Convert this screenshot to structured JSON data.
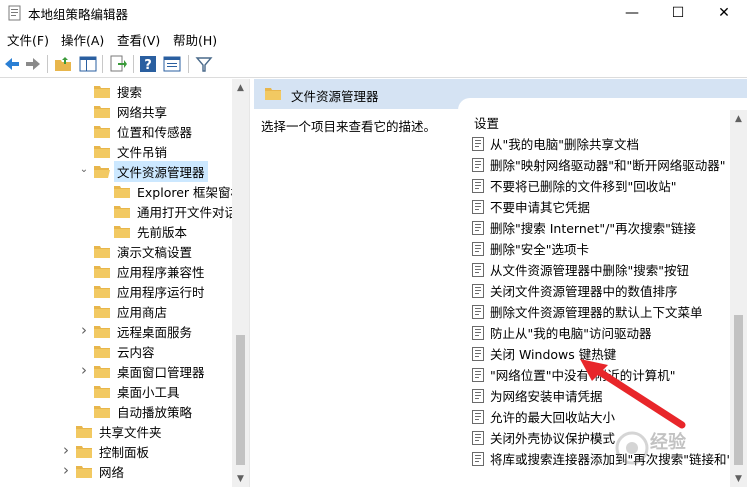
{
  "window": {
    "title": "本地组策略编辑器",
    "minimize_glyph": "—",
    "maximize_glyph": "☐",
    "close_glyph": "✕"
  },
  "menu": [
    "文件(F)",
    "操作(A)",
    "查看(V)",
    "帮助(H)"
  ],
  "toolbar_icons": [
    "back-arrow-icon",
    "forward-arrow-icon",
    "up-folder-icon",
    "show-tree-icon",
    "export-list-icon",
    "help-icon",
    "properties-icon",
    "filter-icon"
  ],
  "tree": {
    "items": [
      {
        "label": "搜索",
        "indent": 1,
        "expand": ""
      },
      {
        "label": "网络共享",
        "indent": 1,
        "expand": ""
      },
      {
        "label": "位置和传感器",
        "indent": 1,
        "expand": ""
      },
      {
        "label": "文件吊销",
        "indent": 1,
        "expand": ""
      },
      {
        "label": "文件资源管理器",
        "indent": 1,
        "expand": "open",
        "selected": true
      },
      {
        "label": "Explorer 框架窗格",
        "indent": 2,
        "expand": ""
      },
      {
        "label": "通用打开文件对话框",
        "indent": 2,
        "expand": ""
      },
      {
        "label": "先前版本",
        "indent": 2,
        "expand": ""
      },
      {
        "label": "演示文稿设置",
        "indent": 1,
        "expand": ""
      },
      {
        "label": "应用程序兼容性",
        "indent": 1,
        "expand": ""
      },
      {
        "label": "应用程序运行时",
        "indent": 1,
        "expand": ""
      },
      {
        "label": "应用商店",
        "indent": 1,
        "expand": ""
      },
      {
        "label": "远程桌面服务",
        "indent": 1,
        "expand": "closed"
      },
      {
        "label": "云内容",
        "indent": 1,
        "expand": ""
      },
      {
        "label": "桌面窗口管理器",
        "indent": 1,
        "expand": "closed"
      },
      {
        "label": "桌面小工具",
        "indent": 1,
        "expand": ""
      },
      {
        "label": "自动播放策略",
        "indent": 1,
        "expand": ""
      },
      {
        "label": "共享文件夹",
        "indent": 0,
        "expand": ""
      },
      {
        "label": "控制面板",
        "indent": 0,
        "expand": "closed"
      },
      {
        "label": "网络",
        "indent": 0,
        "expand": "closed"
      }
    ]
  },
  "right": {
    "header_title": "文件资源管理器",
    "description": "选择一个项目来查看它的描述。",
    "column_header": "设置",
    "settings": [
      "从\"我的电脑\"删除共享文档",
      "删除\"映射网络驱动器\"和\"断开网络驱动器\"",
      "不要将已删除的文件移到\"回收站\"",
      "不要申请其它凭据",
      "删除\"搜索 Internet\"/\"再次搜索\"链接",
      "删除\"安全\"选项卡",
      "从文件资源管理器中删除\"搜索\"按钮",
      "关闭文件资源管理器中的数值排序",
      "删除文件资源管理器的默认上下文菜单",
      "防止从\"我的电脑\"访问驱动器",
      "关闭 Windows 键热键",
      "\"网络位置\"中没有\"附近的计算机\"",
      "为网络安装申请凭据",
      "允许的最大回收站大小",
      "关闭外壳协议保护模式",
      "将库或搜索连接器添加到\"再次搜索\"链接和\"开"
    ]
  },
  "watermark_text": "经验",
  "colors": {
    "header_bg": "#d5e3f3",
    "selection": "#cce8ff",
    "arrow_red": "#e8262a",
    "folder": "#e8b64c"
  }
}
